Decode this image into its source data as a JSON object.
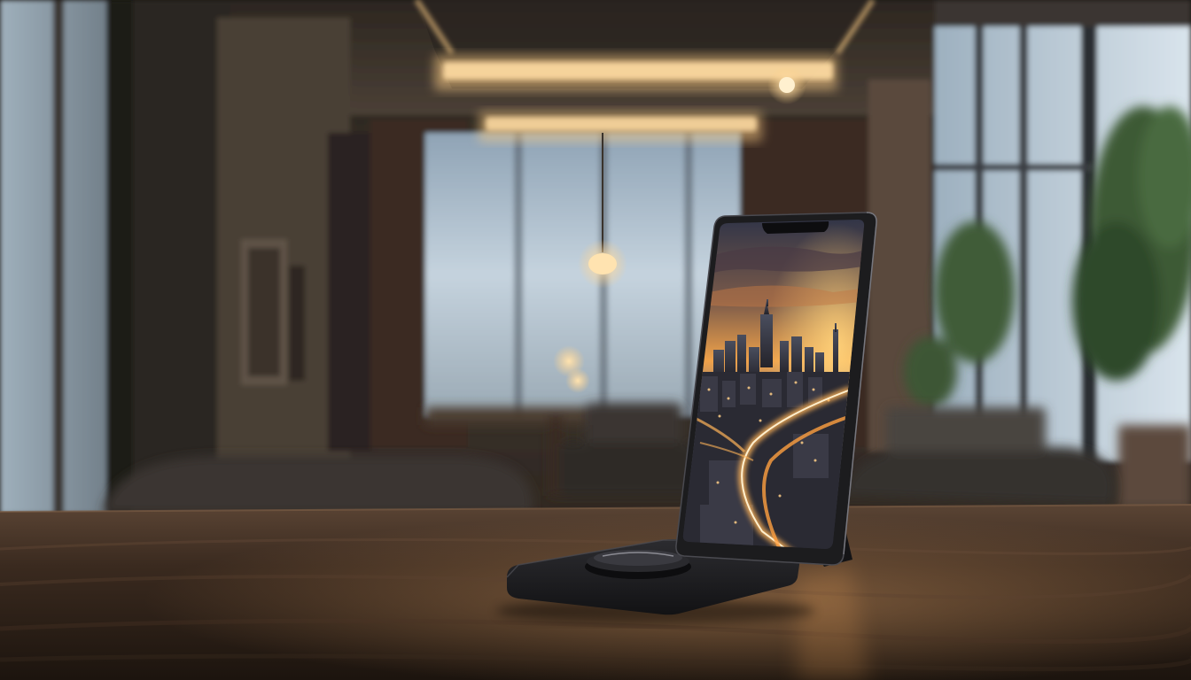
{
  "scene": {
    "description_free": true,
    "phone": {
      "screen_wallpaper": "city-skyline-sunset"
    },
    "colors": {
      "wall_dark": "#2b2622",
      "wall_mid": "#4a4038",
      "window_light": "#c7d6e2",
      "window_glow": "#9fb3c4",
      "ceiling": "#3a332c",
      "cove_light": "#ffcf86",
      "table_top": "#3b2a1e",
      "table_edge": "#20160f",
      "charger": "#1f1f22",
      "phone_frame": "#1c1c1e",
      "sky_top": "#2e3a52",
      "sky_sunset": "#f39a3a",
      "city_glow": "#ffb458"
    }
  }
}
